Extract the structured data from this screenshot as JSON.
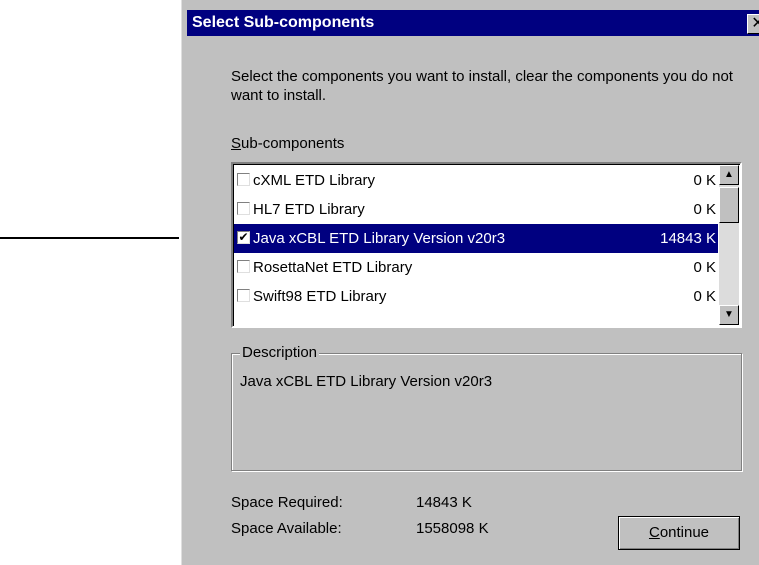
{
  "dialog": {
    "title": "Select Sub-components",
    "close_glyph": "✕",
    "instructions": "Select the components you want to install, clear the components you do not want to install.",
    "list_label_accel": "S",
    "list_label_rest": "ub-components"
  },
  "components": [
    {
      "label": "cXML ETD Library",
      "size": "0 K",
      "checked": false,
      "selected": false
    },
    {
      "label": "HL7 ETD Library",
      "size": "0 K",
      "checked": false,
      "selected": false
    },
    {
      "label": "Java xCBL ETD Library Version v20r3",
      "size": "14843 K",
      "checked": true,
      "selected": true
    },
    {
      "label": "RosettaNet ETD Library",
      "size": "0 K",
      "checked": false,
      "selected": false
    },
    {
      "label": "Swift98 ETD Library",
      "size": "0 K",
      "checked": false,
      "selected": false
    }
  ],
  "description": {
    "legend": "Description",
    "text": "Java xCBL ETD Library Version v20r3"
  },
  "space": {
    "required_label": "Space Required:",
    "required_value": "14843 K",
    "available_label": "Space Available:",
    "available_value": "1558098 K"
  },
  "buttons": {
    "continue_accel": "C",
    "continue_rest": "ontinue"
  },
  "scrollbar": {
    "up_glyph": "▲",
    "down_glyph": "▼"
  },
  "colors": {
    "selection": "#000080",
    "titlebar": "#000080",
    "face": "#c0c0c0"
  }
}
